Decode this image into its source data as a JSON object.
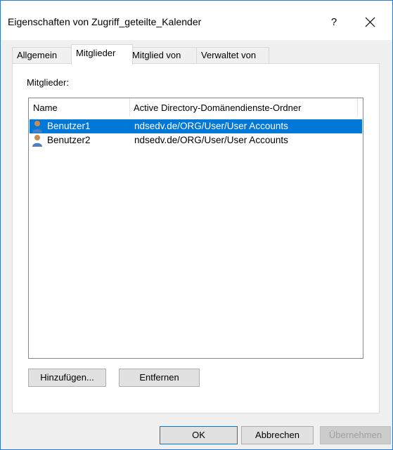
{
  "window": {
    "title": "Eigenschaften von Zugriff_geteilte_Kalender",
    "help_label": "?",
    "close_icon": "close-icon"
  },
  "tabs": [
    {
      "label": "Allgemein",
      "active": false
    },
    {
      "label": "Mitglieder",
      "active": true
    },
    {
      "label": "Mitglied von",
      "active": false
    },
    {
      "label": "Verwaltet von",
      "active": false
    }
  ],
  "members": {
    "label": "Mitglieder:",
    "columns": [
      "Name",
      "Active Directory-Domänendienste-Ordner"
    ],
    "rows": [
      {
        "name": "Benutzer1",
        "folder": "ndsedv.de/ORG/User/User Accounts",
        "selected": true,
        "icon": "user-icon"
      },
      {
        "name": "Benutzer2",
        "folder": "ndsedv.de/ORG/User/User Accounts",
        "selected": false,
        "icon": "user-icon"
      }
    ],
    "add_label": "Hinzufügen...",
    "remove_label": "Entfernen"
  },
  "footer": {
    "ok_label": "OK",
    "cancel_label": "Abbrechen",
    "apply_label": "Übernehmen"
  },
  "colors": {
    "selection": "#0078d7",
    "window_border": "#2b79d0"
  }
}
